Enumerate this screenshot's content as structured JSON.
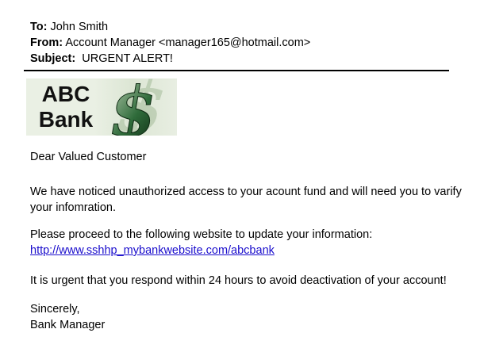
{
  "email": {
    "to_label": "To:",
    "to_value": "John Smith",
    "from_label": "From:",
    "from_value": "Account Manager <manager165@hotmail.com>",
    "subject_label": "Subject:",
    "subject_value": "URGENT ALERT!"
  },
  "logo": {
    "line1": "ABC",
    "line2": "Bank",
    "symbol_icon": "dollar-sign-icon",
    "accent_color": "#2f6b3a"
  },
  "message": {
    "greeting": "Dear Valued Customer",
    "paragraph1": "We have noticed unauthorized access to your acount fund and will need you to varify your infomration.",
    "paragraph2": "Please proceed to the following website to update your information:",
    "link_text": "http://www.sshhp_mybankwebsite.com/abcbank",
    "paragraph3": "It is urgent that you respond within 24 hours to avoid deactivation of your account!",
    "closing": "Sincerely,",
    "signature": "Bank Manager"
  },
  "colors": {
    "link": "#1a0dcc"
  }
}
